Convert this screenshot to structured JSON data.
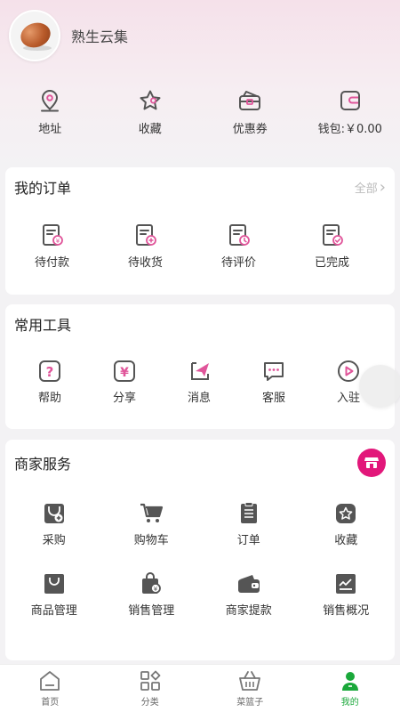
{
  "profile": {
    "name": "熟生云集"
  },
  "quick": [
    {
      "label": "地址",
      "icon": "location-icon"
    },
    {
      "label": "收藏",
      "icon": "star-icon"
    },
    {
      "label": "优惠券",
      "icon": "coupon-icon"
    },
    {
      "label": "钱包:￥0.00",
      "icon": "wallet-icon"
    }
  ],
  "orders": {
    "title": "我的订单",
    "more": "全部",
    "items": [
      {
        "label": "待付款",
        "icon": "pending-payment-icon"
      },
      {
        "label": "待收货",
        "icon": "pending-receipt-icon"
      },
      {
        "label": "待评价",
        "icon": "pending-review-icon"
      },
      {
        "label": "已完成",
        "icon": "completed-icon"
      }
    ]
  },
  "tools": {
    "title": "常用工具",
    "items": [
      {
        "label": "帮助",
        "icon": "help-icon"
      },
      {
        "label": "分享",
        "icon": "share-icon"
      },
      {
        "label": "消息",
        "icon": "message-icon"
      },
      {
        "label": "客服",
        "icon": "customer-service-icon"
      },
      {
        "label": "入驻",
        "icon": "join-icon"
      }
    ]
  },
  "merchant": {
    "title": "商家服务",
    "items": [
      {
        "label": "采购",
        "icon": "purchase-icon"
      },
      {
        "label": "购物车",
        "icon": "cart-icon"
      },
      {
        "label": "订单",
        "icon": "order-list-icon"
      },
      {
        "label": "收藏",
        "icon": "favorite-icon"
      },
      {
        "label": "商品管理",
        "icon": "product-manage-icon"
      },
      {
        "label": "销售管理",
        "icon": "sales-manage-icon"
      },
      {
        "label": "商家提款",
        "icon": "withdraw-icon"
      },
      {
        "label": "销售概况",
        "icon": "sales-overview-icon"
      }
    ]
  },
  "tabbar": [
    {
      "label": "首页",
      "icon": "home-icon"
    },
    {
      "label": "分类",
      "icon": "category-icon"
    },
    {
      "label": "菜篮子",
      "icon": "basket-icon"
    },
    {
      "label": "我的",
      "icon": "profile-icon",
      "active": true
    }
  ],
  "colors": {
    "accent": "#e2177a",
    "icon": "#555555",
    "pink": "#e0559a",
    "active_tab": "#1aa83a"
  }
}
